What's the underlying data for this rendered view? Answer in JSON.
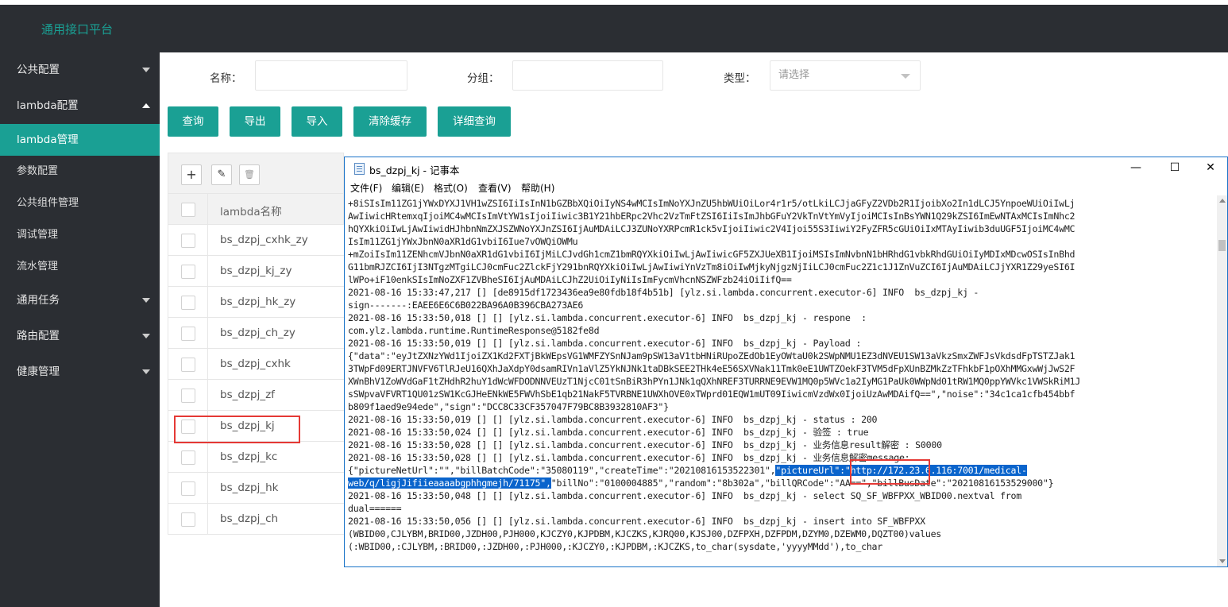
{
  "app": {
    "title": "通用接口平台"
  },
  "sidebar": {
    "items": [
      {
        "label": "公共配置"
      },
      {
        "label": "lambda配置"
      },
      {
        "label": "lambda管理"
      },
      {
        "label": "参数配置"
      },
      {
        "label": "公共组件管理"
      },
      {
        "label": "调试管理"
      },
      {
        "label": "流水管理"
      },
      {
        "label": "通用任务"
      },
      {
        "label": "路由配置"
      },
      {
        "label": "健康管理"
      }
    ]
  },
  "search": {
    "name_label": "名称：",
    "group_label": "分组：",
    "type_label": "类型：",
    "type_placeholder": "请选择",
    "name_value": "",
    "group_value": ""
  },
  "buttons": {
    "query": "查询",
    "export": "导出",
    "import": "导入",
    "clear_cache": "清除缓存",
    "detail_query": "详细查询"
  },
  "table": {
    "toolbar": {
      "add": "+",
      "edit": "✎",
      "delete": "🗑"
    },
    "header": "lambda名称",
    "rows": [
      "bs_dzpj_cxhk_zy",
      "bs_dzpj_kj_zy",
      "bs_dzpj_hk_zy",
      "bs_dzpj_ch_zy",
      "bs_dzpj_cxhk",
      "bs_dzpj_zf",
      "bs_dzpj_kj",
      "bs_dzpj_kc",
      "bs_dzpj_hk",
      "bs_dzpj_ch"
    ]
  },
  "notepad": {
    "title": "bs_dzpj_kj - 记事本",
    "controls": {
      "minimize": "—",
      "maximize": "☐",
      "close": "✕"
    },
    "menu": [
      "文件(F)",
      "编辑(E)",
      "格式(O)",
      "查看(V)",
      "帮助(H)"
    ],
    "lines": [
      "+8iSIsIm11ZG1jYWxDYXJ1VH1wZSI6IiIsInN1bGZBbXQiOiIyNS4wMCIsImNoYXJnZU5hbWUiOiLor4r1r5/otLkiLCJjaGFyZ2VDb2R1IjoibXo2In1dLCJ5YnpoeWUiOiIwLj",
      "AwIiwicHRtemxqIjoiMC4wMCIsImVtYW1sIjoiIiwic3B1Y21hbERpc2Vhc2VzTmFtZSI6IiIsImJhbGFuY2VkTnVtYmVyIjoiMCIsInBsYWN1Q29kZSI6ImEwNTAxMCIsImNhc2",
      "hQYXkiOiIwLjAwIiwidHJhbnNmZXJSZWNoYXJnZSI6IjAuMDAiLCJ3ZUNoYXRPcmR1ck5vIjoiIiwic2V4Ijoi55S3IiwiY2FyZFR5cGUiOiIxMTAyIiwib3duUGF5IjoiMC4wMC",
      "IsIm11ZG1jYWxJbnN0aXR1dG1vbiI6Iue7vOWQiOWMu",
      "+mZoiIsIm11ZENhcmVJbnN0aXR1dG1vbiI6IjMiLCJvdGh1cmZ1bmRQYXkiOiIwLjAwIiwicGF5ZXJUeXB1IjoiMSIsImNvbnN1bHRhdG1vbkRhdGUiOiIyMDIxMDcwOSIsInBhd",
      "G11bmRJZCI6IjI3NTgzMTgiLCJ0cmFuc2ZlckFjY291bnRQYXkiOiIwLjAwIiwiYnVzTm8iOiIwMjkyNjgzNjIiLCJ0cmFuc2Z1c1J1ZnVuZCI6IjAuMDAiLCJjYXR1Z29yeSI6I",
      "lWPo+iF10enkSIsImNoZXF1ZVBheSI6IjAuMDAiLCJhZ2UiOiIyNiIsImFycmVhcnNSZWFzb24iOiIifQ==",
      "2021-08-16 15:33:47,217 [] [de8915df1723436ea9e80fdb18f4b51b] [ylz.si.lambda.concurrent.executor-6] INFO  bs_dzpj_kj -",
      "sign-------:EAEE6E6C6B022BA96A0B396CBA273AE6",
      "2021-08-16 15:33:50,018 [] [] [ylz.si.lambda.concurrent.executor-6] INFO  bs_dzpj_kj - respone  :",
      "com.ylz.lambda.runtime.RuntimeResponse@5182fe8d",
      "2021-08-16 15:33:50,019 [] [] [ylz.si.lambda.concurrent.executor-6] INFO  bs_dzpj_kj - Payload :",
      "{\"data\":\"eyJtZXNzYWd1IjoiZX1Kd2FXTjBkWEpsVG1WMFZYSnNJam9pSW13aV1tbHNiRUpoZEdOb1EyOWtaU0k2SWpNMU1EZ3dNVEU1SW13aVkzSmxZWFJsVkdsdFpTSTZJak1",
      "3TWpFd09ERTJNVFV6TlRJeU16QXhJaXdpY0dsamRIVn1aVlZ5YkNJNk1taDBkSEE2THk4eE56SXVNak11Tmk0eE1UWTZOekF3TVM5dFpXUnBZMkZzTFhkbF1pOXhMMGxwWjJwS2F",
      "XWnBhV1ZoWVdGaF1tZHdhR2huY1dWcWFDODNNVEUzT1NjcC01tSnBiR3hPYn1JNk1qQXhNREF3TURRNE9EVW1MQ0p5WVc1a2IyMG1PaUk0WWpNd01tRW1MQ0ppYWVkc1VWSkRiM1J",
      "sSWpvaVFVRT1QU01zSW1KcGJHeENkWE5FWVhSbE1qb21NakF5TVRBNE1UWXhOVE0xTWprd01EQW1mUT09IiwicmVzdWx0IjoiUzAwMDAifQ==\",\"noise\":\"34c1ca1cfb454bbf",
      "b809f1aed9e94ede\",\"sign\":\"DCC8C33CF357047F79BC8B3932810AF3\"}",
      "2021-08-16 15:33:50,019 [] [] [ylz.si.lambda.concurrent.executor-6] INFO  bs_dzpj_kj - status : 200",
      "2021-08-16 15:33:50,024 [] [] [ylz.si.lambda.concurrent.executor-6] INFO  bs_dzpj_kj - 验签 : true",
      "2021-08-16 15:33:50,028 [] [] [ylz.si.lambda.concurrent.executor-6] INFO  bs_dzpj_kj - 业务信息result解密 : S0000",
      "2021-08-16 15:33:50,028 [] [] [ylz.si.lambda.concurrent.executor-6] INFO  bs_dzpj_kj - 业务信息解密message:",
      "{\"pictureNetUrl\":\"\",\"billBatchCode\":\"35080119\",\"createTime\":\"20210816153522301\",",
      "web/q/ligjJifiieaaaabgphhgmejh/71175\",",
      "2021-08-16 15:33:50,048 [] [] [ylz.si.lambda.concurrent.executor-6] INFO  bs_dzpj_kj - select SQ_SF_WBFPXX_WBID00.nextval from",
      "dual======",
      "2021-08-16 15:33:50,056 [] [] [ylz.si.lambda.concurrent.executor-6] INFO  bs_dzpj_kj - insert into SF_WBFPXX",
      "(WBID00,CJLYBM,BRID00,JZDH00,PJH000,KJCZY0,KJPDBM,KJCZKS,KJRQ00,KJSJ00,DZFPXH,DZFPDM,DZYM0,DZEWM0,DQZT00)values",
      "(:WBID00,:CJLYBM,:BRID00,:JZDH00,:PJH000,:KJCZY0,:KJPDBM,:KJCZKS,to_char(sysdate,'yyyyMMdd'),to_char"
    ],
    "highlight_tail": "\"pictureUrl\":\"http://172.23.6.116:7001/medical-",
    "line23_tail": "\"billNo\":\"0100004885\",\"random\":\"8b302a\",\"billQRCode\":\"AA==\",\"billBusDate\":\"20210816153529000\"}"
  }
}
